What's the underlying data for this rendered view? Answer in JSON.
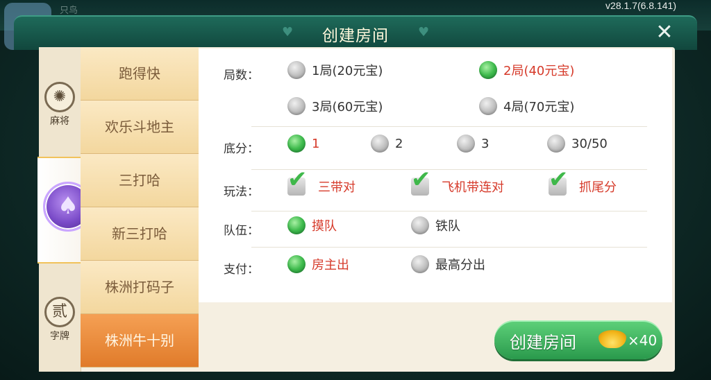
{
  "version": "v28.1.7(6.8.141)",
  "background": {
    "name": "只鸟"
  },
  "dialog": {
    "title": "创建房间",
    "close_icon": "close-icon"
  },
  "categories": [
    {
      "label": "麻将",
      "icon": "mahjong-icon",
      "glyph": "✺"
    },
    {
      "label": "",
      "icon": "spade-icon",
      "glyph": "♠",
      "active": true
    },
    {
      "label": "字牌",
      "icon": "zipai-icon",
      "glyph": "贰"
    }
  ],
  "games": [
    "跑得快",
    "欢乐斗地主",
    "三打哈",
    "新三打哈",
    "株洲打码子",
    "株洲牛十别"
  ],
  "selected_game": "株洲牛十别",
  "rounds": {
    "label": "局数：",
    "options": [
      "1局(20元宝)",
      "2局(40元宝)",
      "3局(60元宝)",
      "4局(70元宝)"
    ],
    "selected": "2局(40元宝)"
  },
  "base_score": {
    "label": "底分：",
    "options": [
      "1",
      "2",
      "3",
      "30/50"
    ],
    "selected": "1"
  },
  "play_mode": {
    "label": "玩法：",
    "options": [
      "三带对",
      "飞机带连对",
      "抓尾分"
    ],
    "checked": [
      "三带对",
      "飞机带连对",
      "抓尾分"
    ]
  },
  "team": {
    "label": "队伍：",
    "options": [
      "摸队",
      "铁队"
    ],
    "selected": "摸队"
  },
  "payment": {
    "label": "支付：",
    "options": [
      "房主出",
      "最高分出"
    ],
    "selected": "房主出"
  },
  "create_button": {
    "label": "创建房间",
    "cost": "×40",
    "ingot_icon": "gold-ingot-icon"
  },
  "colors": {
    "accent_green": "#3fbb4d",
    "selected_text": "#d63a2a",
    "header": "#1e6a5a",
    "tab_selected": "#e07b2a"
  }
}
